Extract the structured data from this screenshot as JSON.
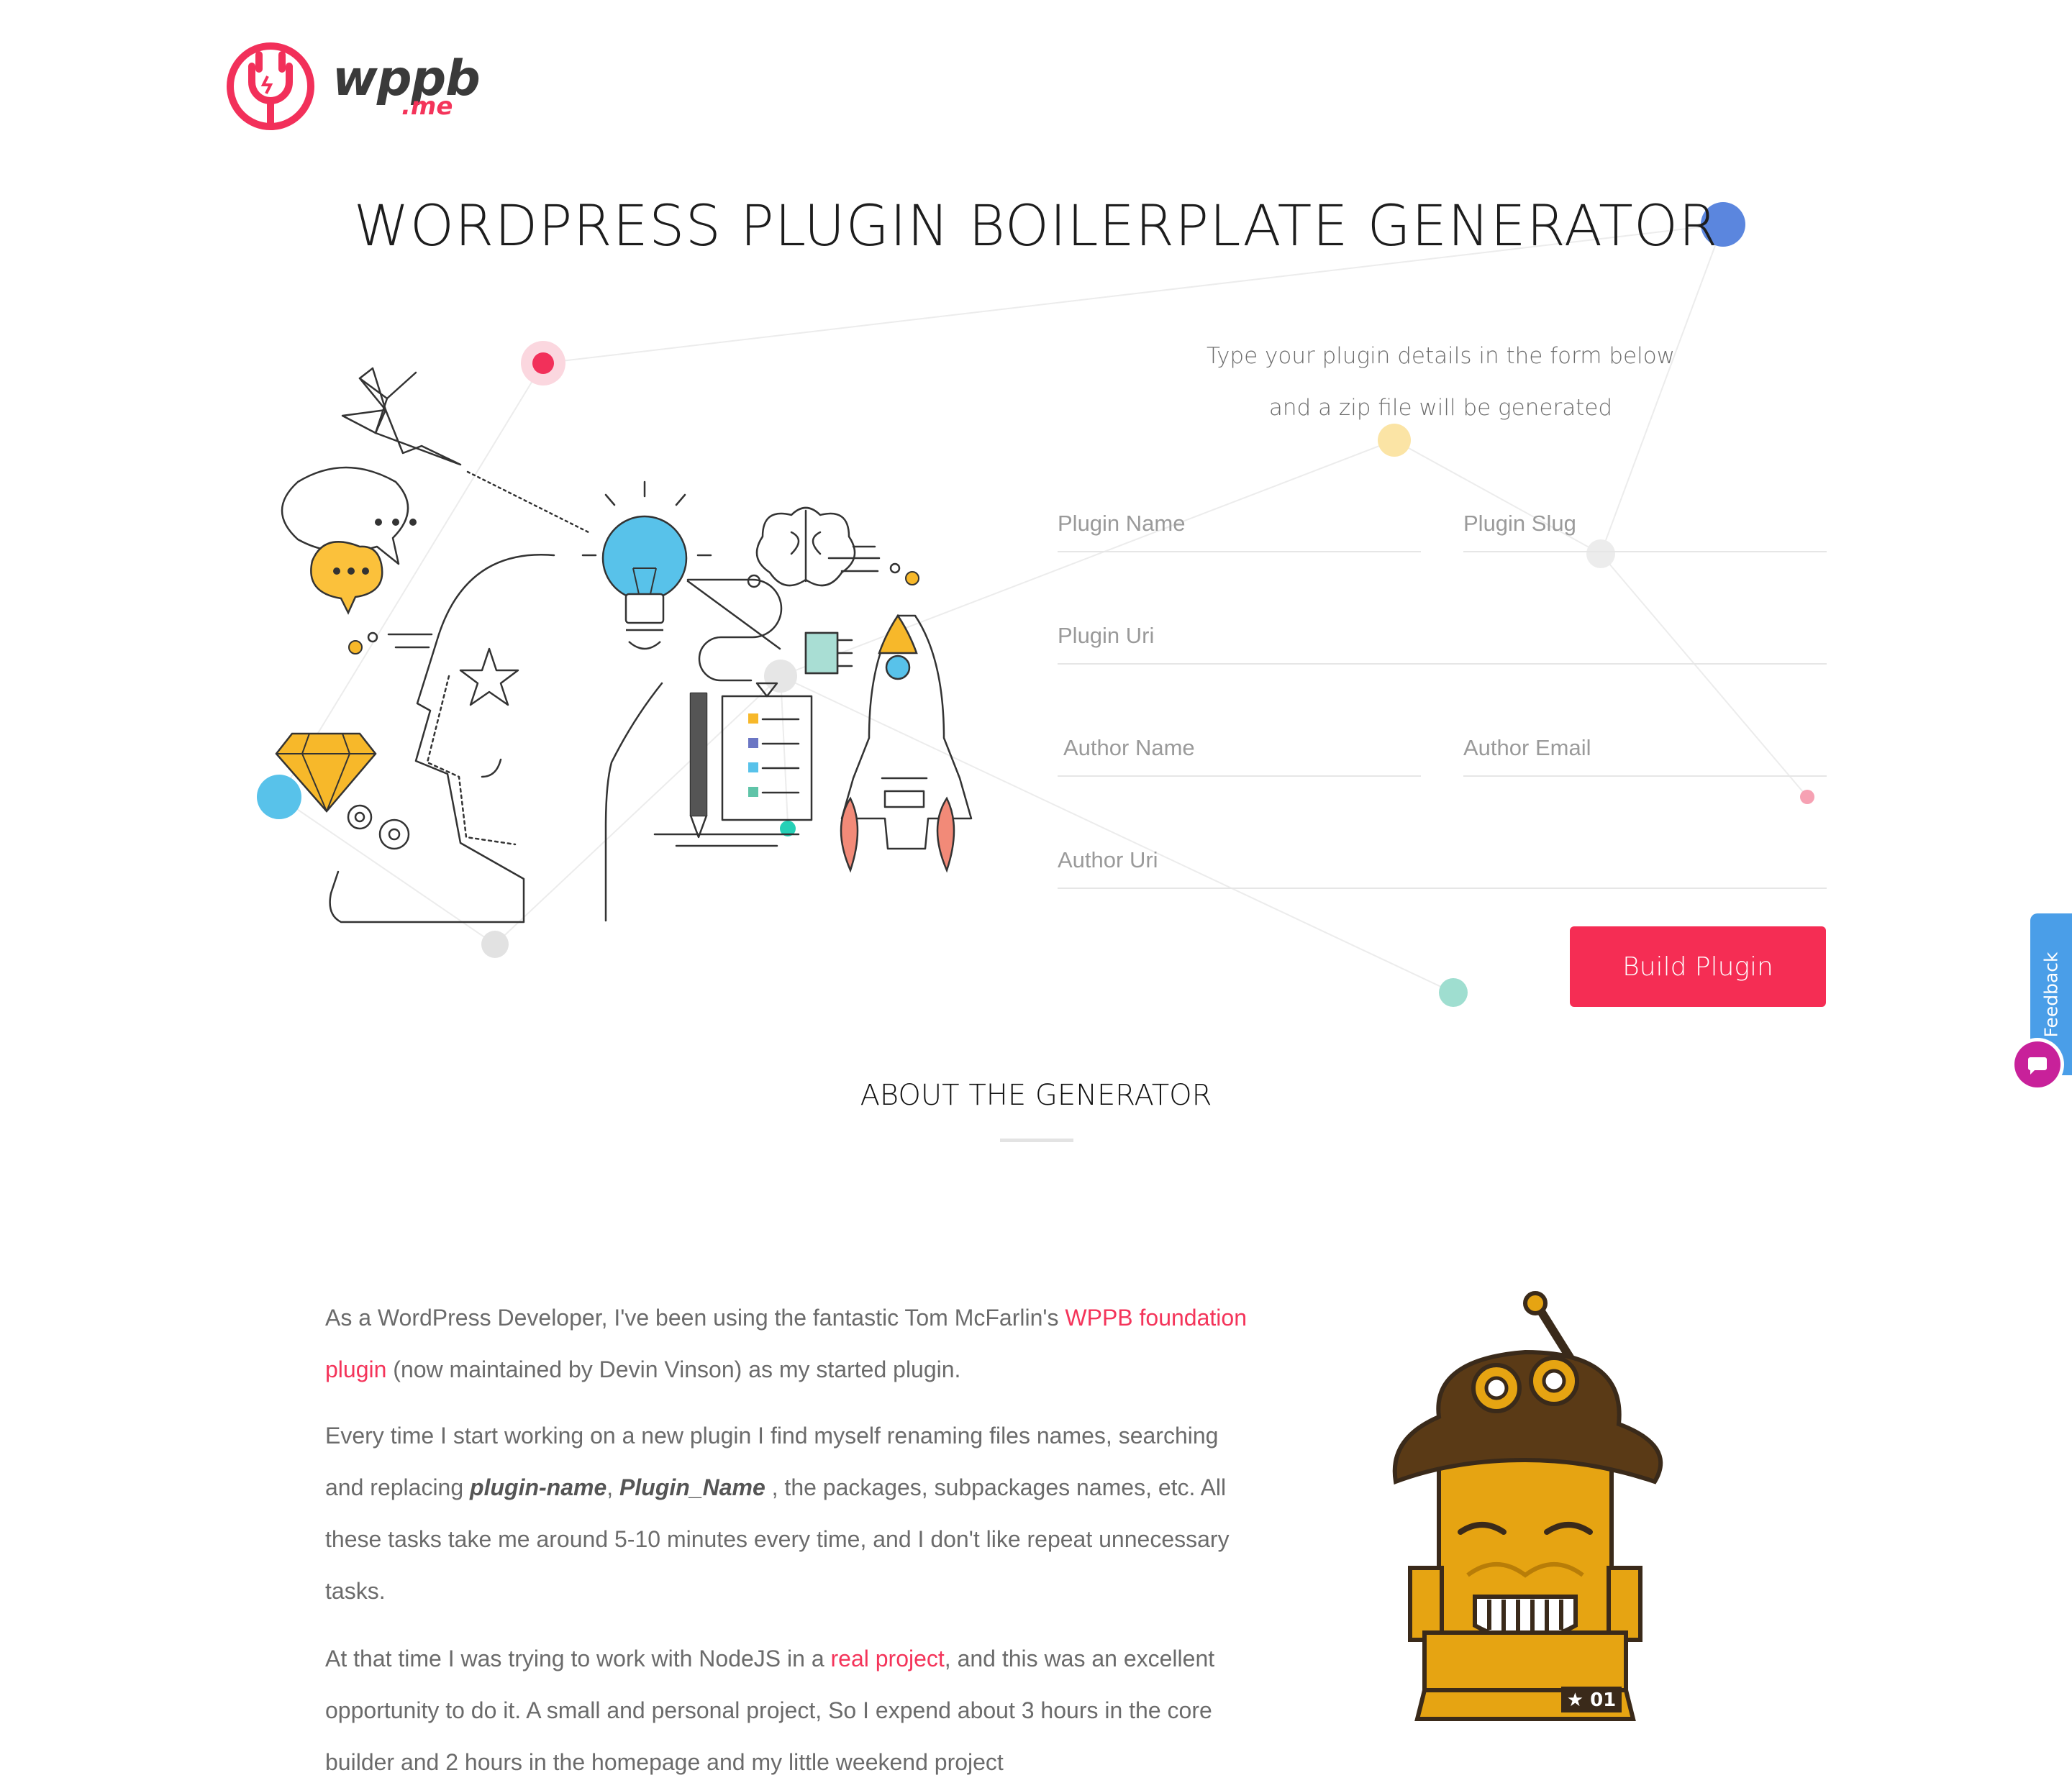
{
  "header": {
    "logo_text": "wppb",
    "logo_sub": ".me"
  },
  "main_title": "WORDPRESS PLUGIN BOILERPLATE GENERATOR",
  "intro": {
    "line1": "Type your plugin details in the form below",
    "line2": "and a zip file will be generated"
  },
  "form": {
    "plugin_name_placeholder": "Plugin Name",
    "plugin_slug_placeholder": "Plugin Slug",
    "plugin_uri_placeholder": "Plugin Uri",
    "author_name_placeholder": "Author Name",
    "author_email_placeholder": "Author Email",
    "author_uri_placeholder": "Author Uri",
    "build_label": "Build Plugin"
  },
  "feedback": {
    "label": "Feedback"
  },
  "about": {
    "title": "ABOUT THE GENERATOR",
    "p1": {
      "t1": "As a WordPress Developer, I've been using the fantastic Tom McFarlin's ",
      "link": "WPPB foundation plugin",
      "t2": " (now maintained by Devin Vinson) as my started plugin."
    },
    "p2": {
      "t1": "Every time I start working on a new plugin I find myself renaming files names, searching and replacing ",
      "b1": "plugin-name",
      "t2": ", ",
      "b2": "Plugin_Name",
      "t3": " , the packages, subpackages names, etc. All these tasks take me around 5-10 minutes every time, and I don't like repeat unnecessary tasks."
    },
    "p3": {
      "t1": "At that time I was trying to work with NodeJS in a ",
      "link": "real project",
      "t2": ", and this was an excellent opportunity to do it. A small and personal project, So I expend about 3 hours in the core builder and 2 hours in the homepage and my little weekend project"
    }
  },
  "robot_badge": "★ 01",
  "colors": {
    "accent": "#f52d54",
    "feedback_tab": "#4a9ee8",
    "chat_button": "#c8219a"
  }
}
